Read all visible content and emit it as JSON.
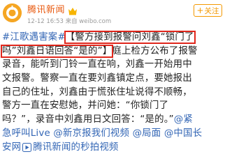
{
  "account": {
    "name": "腾讯新闻",
    "meta": "12-12 16:53 来自 weibo.com",
    "follow_label": "关注",
    "follow_plus": "+"
  },
  "post": {
    "topic": "#江歌遇害案#",
    "highlight_1a": "【警方接到报警问刘鑫“锁门了",
    "highlight_1b": "吗”刘鑫日语回答“是的”】",
    "text_1": "庭上检方公布了报警",
    "text_2": "录音，能听到门铃一直在响，刘鑫一开始用中",
    "text_3": "文报警。警察一直在要刘鑫镇定点，要她报出",
    "text_4": "自己的住址，刘鑫由于慌张住址说得不顺畅，",
    "text_5": "警方一直在安慰她，并问她：“你锁门了",
    "text_6a": "吗？”，录音中刘鑫用日文回答：“是的。”",
    "mention_1": "@紧",
    "mention_1b": "急呼叫Live",
    "mention_2": "@新京报我们视频",
    "mention_3": "@局面",
    "mention_4": "@中国长",
    "mention_4b": "安网",
    "source_text": "腾讯新闻的秒拍视频"
  },
  "colors": {
    "accent_orange": "#e8580d",
    "link_blue": "#3366b5",
    "highlight_red": "#e0261b"
  },
  "icons": [
    "tencent-news-avatar",
    "vip-crown-icon",
    "video-play-icon"
  ]
}
